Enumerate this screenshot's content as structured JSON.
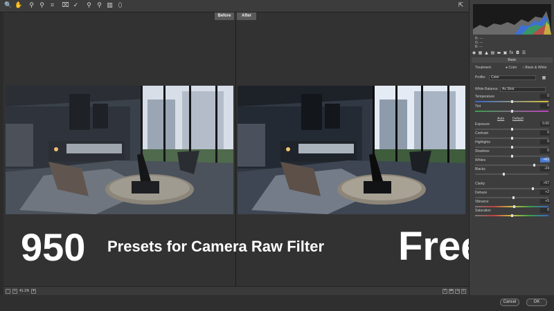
{
  "toolbar": {
    "tools": [
      "🔍",
      "✋",
      "⚲",
      "⚲",
      "⌗",
      "⌧",
      "✓",
      "⚲",
      "⚲",
      "▥",
      "⬯"
    ],
    "right_icon": "⇱"
  },
  "tabs": {
    "before": "Before",
    "after": "After"
  },
  "bottom": {
    "zoom": "41.1%"
  },
  "buttons": {
    "cancel": "Cancel",
    "ok": "OK"
  },
  "panel": {
    "rgb": [
      "R:  ---",
      "G:  ---",
      "B:  ---"
    ],
    "section": "Basic",
    "treatment_label": "Treatment:",
    "treatment_color": "Color",
    "treatment_bw": "Black & White",
    "profile_label": "Profile:",
    "profile_value": "Color",
    "wb_label": "White Balance:",
    "wb_value": "As Shot",
    "temperature_label": "Temperature",
    "temperature_value": "0",
    "tint_label": "Tint",
    "tint_value": "0",
    "auto": "Auto",
    "default": "Default",
    "exposure_label": "Exposure",
    "exposure_value": "0.00",
    "contrast_label": "Contrast",
    "contrast_value": "0",
    "highlights_label": "Highlights",
    "highlights_value": "0",
    "shadows_label": "Shadows",
    "shadows_value": "0",
    "whites_label": "Whites",
    "whites_value": "+61",
    "blacks_label": "Blacks",
    "blacks_value": "-24",
    "clarity_label": "Clarity",
    "clarity_value": "+57",
    "dehaze_label": "Dehaze",
    "dehaze_value": "+2",
    "vibrance_label": "Vibrance",
    "vibrance_value": "+5",
    "saturation_label": "Saturation",
    "saturation_value": "0"
  },
  "caption": {
    "number": "950",
    "text": "Presets for Camera Raw Filter",
    "free": "Free"
  }
}
